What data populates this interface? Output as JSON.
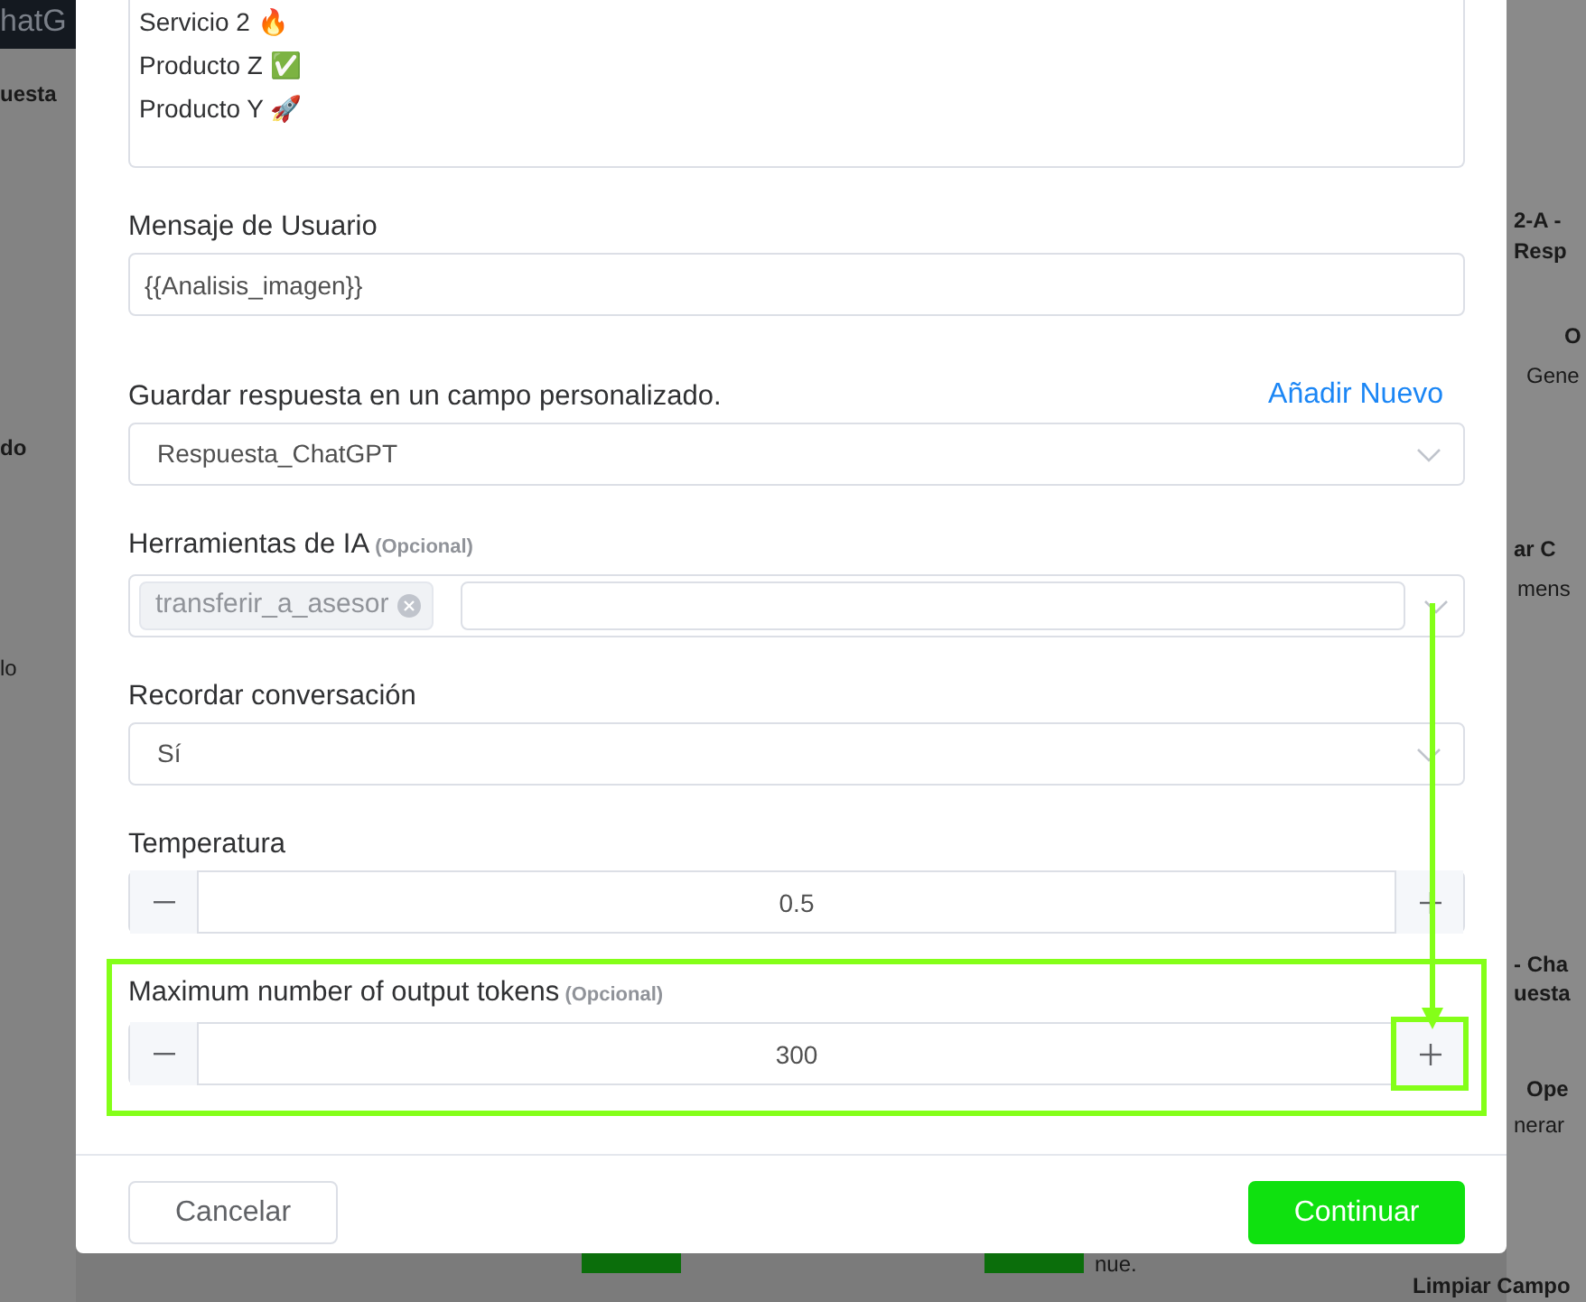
{
  "background": {
    "fragments": [
      {
        "text": "hatG",
        "kind": "topbar"
      },
      {
        "text": "uesta",
        "kind": "bold"
      },
      {
        "text": "do",
        "kind": "bold"
      },
      {
        "text": "lo",
        "kind": "plain"
      },
      {
        "text": "2-A -",
        "kind": "bold"
      },
      {
        "text": "Resp",
        "kind": "bold"
      },
      {
        "text": "O",
        "kind": "bold"
      },
      {
        "text": "Gene",
        "kind": "plain"
      },
      {
        "text": "ar C",
        "kind": "bold"
      },
      {
        "text": "mens",
        "kind": "plain"
      },
      {
        "text": "- Cha",
        "kind": "bold"
      },
      {
        "text": "uesta",
        "kind": "bold"
      },
      {
        "text": "Ope",
        "kind": "bold"
      },
      {
        "text": "nerar",
        "kind": "plain"
      },
      {
        "text": "Limpiar Campo",
        "kind": "bold"
      },
      {
        "text": "nue.",
        "kind": "plain"
      }
    ]
  },
  "modal": {
    "textarea_lines": [
      "Servicio 2 🔥",
      "Producto Z ✅",
      "Producto Y 🚀"
    ],
    "fields": [
      {
        "kind": "text",
        "label": "Mensaje de Usuario",
        "value": "{{Analisis_imagen}}",
        "highlighted": false
      },
      {
        "kind": "select",
        "label": "Guardar respuesta en un campo personalizado.",
        "action": "Añadir Nuevo",
        "value": "Respuesta_ChatGPT",
        "highlighted": false
      },
      {
        "kind": "tags",
        "label": "Herramientas de IA",
        "note": "(Opcional)",
        "tags": [
          "transferir_a_asesor"
        ],
        "highlighted": false
      },
      {
        "kind": "select",
        "label": "Recordar conversación",
        "value": "Sí",
        "highlighted": false
      },
      {
        "kind": "number",
        "label": "Temperatura",
        "value": "0.5",
        "highlighted": false
      },
      {
        "kind": "number",
        "label": "Maximum number of output tokens",
        "note": "(Opcional)",
        "value": "300",
        "highlighted": true
      }
    ],
    "buttons": [
      {
        "label": "Cancelar",
        "kind": "secondary"
      },
      {
        "label": "Continuar",
        "kind": "primary"
      }
    ]
  }
}
